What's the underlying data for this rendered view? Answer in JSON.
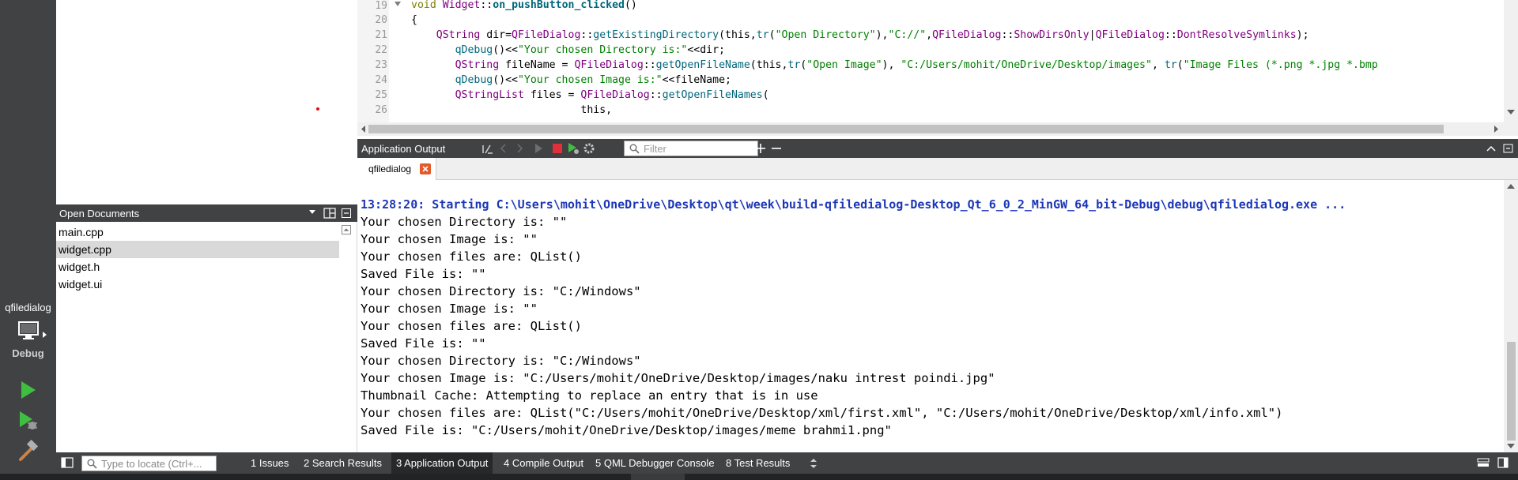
{
  "window": {
    "title": "qfiledialog"
  },
  "modebar": {
    "kit_label": "qfiledialog",
    "kit_mode": "Debug",
    "kit_icon": "monitor-icon",
    "buttons": [
      {
        "name": "run-button",
        "icon": "play-icon"
      },
      {
        "name": "debug-run-button",
        "icon": "bug-play-icon"
      },
      {
        "name": "build-button",
        "icon": "hammer-icon"
      }
    ]
  },
  "sidebar": {
    "open_documents_title": "Open Documents",
    "documents": [
      {
        "label": "main.cpp",
        "selected": false
      },
      {
        "label": "widget.cpp",
        "selected": true
      },
      {
        "label": "widget.h",
        "selected": false
      },
      {
        "label": "widget.ui",
        "selected": false
      }
    ]
  },
  "editor": {
    "line_numbers": [
      "19",
      "20",
      "21",
      "22",
      "23",
      "24",
      "25",
      "26"
    ],
    "code": {
      "l19": {
        "kw": "void",
        "sp": " ",
        "cls": "Widget",
        "sep": "::",
        "fn": "on_pushButton_clicked",
        "rest": "()"
      },
      "l20": "{",
      "l21": {
        "indent": "    ",
        "type": "QString",
        "a": " dir=",
        "cls": "QFileDialog",
        "sep": "::",
        "fn": "getExistingDirectory",
        "b": "(this,",
        "tr": "tr",
        "c": "(",
        "s1": "\"Open Directory\"",
        "d": "),",
        "s2": "\"C://\"",
        "e": ",",
        "cls2": "QFileDialog",
        "sep2": "::",
        "en1": "ShowDirsOnly",
        "f": "|",
        "cls3": "QFileDialog",
        "sep3": "::",
        "en2": "DontResolveSymlinks",
        "g": ");"
      },
      "l22": {
        "indent": "       ",
        "fn": "qDebug",
        "a": "()<<",
        "s1": "\"Your chosen Directory is:\"",
        "b": "<<dir;"
      },
      "l23": {
        "indent": "       ",
        "type": "QString",
        "a": " fileName = ",
        "cls": "QFileDialog",
        "sep": "::",
        "fn": "getOpenFileName",
        "b": "(this,",
        "tr": "tr",
        "c": "(",
        "s1": "\"Open Image\"",
        "d": "), ",
        "s2": "\"C:/Users/mohit/OneDrive/Desktop/images\"",
        "e": ", ",
        "tr2": "tr",
        "f": "(",
        "s3": "\"Image Files (*.png *.jpg *.bmp"
      },
      "l24": {
        "indent": "       ",
        "fn": "qDebug",
        "a": "()<<",
        "s1": "\"Your chosen Image is:\"",
        "b": "<<fileName;"
      },
      "l25": {
        "indent": "       ",
        "type": "QStringList",
        "a": " files = ",
        "cls": "QFileDialog",
        "sep": "::",
        "fn": "getOpenFileNames",
        "b": "("
      },
      "l26": {
        "indent": "                           ",
        "a": "this,"
      }
    }
  },
  "output": {
    "pane_title": "Application Output",
    "filter_placeholder": "Filter",
    "tab_label": "qfiledialog",
    "lines": [
      "13:28:20: Starting C:\\Users\\mohit\\OneDrive\\Desktop\\qt\\week\\build-qfiledialog-Desktop_Qt_6_0_2_MinGW_64_bit-Debug\\debug\\qfiledialog.exe ...",
      "Your chosen Directory is: \"\"",
      "Your chosen Image is: \"\"",
      "Your chosen files are: QList()",
      "Saved File is: \"\"",
      "Your chosen Directory is: \"C:/Windows\"",
      "Your chosen Image is: \"\"",
      "Your chosen files are: QList()",
      "Saved File is: \"\"",
      "Your chosen Directory is: \"C:/Windows\"",
      "Your chosen Image is: \"C:/Users/mohit/OneDrive/Desktop/images/naku intrest poindi.jpg\"",
      "Thumbnail Cache: Attempting to replace an entry that is in use",
      "Your chosen files are: QList(\"C:/Users/mohit/OneDrive/Desktop/xml/first.xml\", \"C:/Users/mohit/OneDrive/Desktop/xml/info.xml\")",
      "Saved File is: \"C:/Users/mohit/OneDrive/Desktop/images/meme brahmi1.png\""
    ]
  },
  "statusbar": {
    "locator_placeholder": "Type to locate (Ctrl+...",
    "panes": [
      {
        "label": "1  Issues",
        "active": false
      },
      {
        "label": "2  Search Results",
        "active": false
      },
      {
        "label": "3  Application Output",
        "active": true
      },
      {
        "label": "4  Compile Output",
        "active": false
      },
      {
        "label": "5  QML Debugger Console",
        "active": false
      },
      {
        "label": "8  Test Results",
        "active": false
      }
    ]
  },
  "colors": {
    "modebar_bg": "#404244",
    "output_start_line": "#1c36b8",
    "keyword": "#808000",
    "function": "#00677c",
    "string": "#008000",
    "type": "#800080"
  }
}
